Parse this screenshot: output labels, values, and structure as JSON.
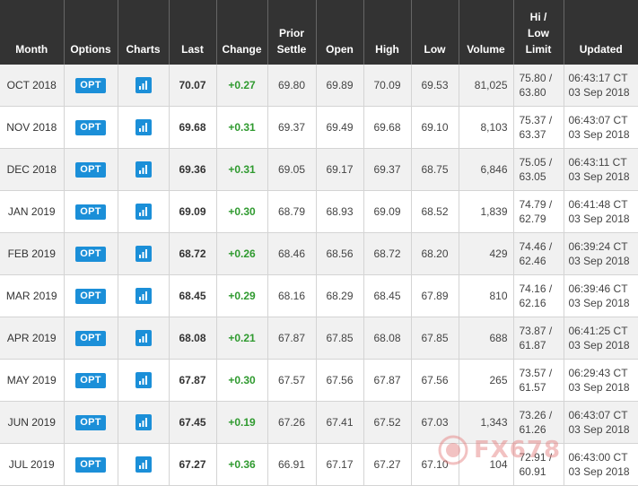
{
  "headers": {
    "month": "Month",
    "options": "Options",
    "charts": "Charts",
    "last": "Last",
    "change": "Change",
    "prior_settle_1": "Prior",
    "prior_settle_2": "Settle",
    "open": "Open",
    "high": "High",
    "low": "Low",
    "volume": "Volume",
    "limit_1": "Hi /",
    "limit_2": "Low",
    "limit_3": "Limit",
    "updated": "Updated"
  },
  "opt_label": "OPT",
  "chart_icon": "bar-chart-icon",
  "colors": {
    "header_bg": "#333333",
    "opt_blue": "#1b8fd8",
    "positive_green": "#2f9a2f",
    "row_alt": "#f1f1f1"
  },
  "rows": [
    {
      "month": "OCT 2018",
      "last": "70.07",
      "change": "+0.27",
      "prior_settle": "69.80",
      "open": "69.89",
      "high": "70.09",
      "low": "69.53",
      "volume": "81,025",
      "hi_limit": "75.80 /",
      "low_limit": "63.80",
      "time": "06:43:17 CT",
      "date": "03 Sep 2018"
    },
    {
      "month": "NOV 2018",
      "last": "69.68",
      "change": "+0.31",
      "prior_settle": "69.37",
      "open": "69.49",
      "high": "69.68",
      "low": "69.10",
      "volume": "8,103",
      "hi_limit": "75.37 /",
      "low_limit": "63.37",
      "time": "06:43:07 CT",
      "date": "03 Sep 2018"
    },
    {
      "month": "DEC 2018",
      "last": "69.36",
      "change": "+0.31",
      "prior_settle": "69.05",
      "open": "69.17",
      "high": "69.37",
      "low": "68.75",
      "volume": "6,846",
      "hi_limit": "75.05 /",
      "low_limit": "63.05",
      "time": "06:43:11 CT",
      "date": "03 Sep 2018"
    },
    {
      "month": "JAN 2019",
      "last": "69.09",
      "change": "+0.30",
      "prior_settle": "68.79",
      "open": "68.93",
      "high": "69.09",
      "low": "68.52",
      "volume": "1,839",
      "hi_limit": "74.79 /",
      "low_limit": "62.79",
      "time": "06:41:48 CT",
      "date": "03 Sep 2018"
    },
    {
      "month": "FEB 2019",
      "last": "68.72",
      "change": "+0.26",
      "prior_settle": "68.46",
      "open": "68.56",
      "high": "68.72",
      "low": "68.20",
      "volume": "429",
      "hi_limit": "74.46 /",
      "low_limit": "62.46",
      "time": "06:39:24 CT",
      "date": "03 Sep 2018"
    },
    {
      "month": "MAR 2019",
      "last": "68.45",
      "change": "+0.29",
      "prior_settle": "68.16",
      "open": "68.29",
      "high": "68.45",
      "low": "67.89",
      "volume": "810",
      "hi_limit": "74.16 /",
      "low_limit": "62.16",
      "time": "06:39:46 CT",
      "date": "03 Sep 2018"
    },
    {
      "month": "APR 2019",
      "last": "68.08",
      "change": "+0.21",
      "prior_settle": "67.87",
      "open": "67.85",
      "high": "68.08",
      "low": "67.85",
      "volume": "688",
      "hi_limit": "73.87 /",
      "low_limit": "61.87",
      "time": "06:41:25 CT",
      "date": "03 Sep 2018"
    },
    {
      "month": "MAY 2019",
      "last": "67.87",
      "change": "+0.30",
      "prior_settle": "67.57",
      "open": "67.56",
      "high": "67.87",
      "low": "67.56",
      "volume": "265",
      "hi_limit": "73.57 /",
      "low_limit": "61.57",
      "time": "06:29:43 CT",
      "date": "03 Sep 2018"
    },
    {
      "month": "JUN 2019",
      "last": "67.45",
      "change": "+0.19",
      "prior_settle": "67.26",
      "open": "67.41",
      "high": "67.52",
      "low": "67.03",
      "volume": "1,343",
      "hi_limit": "73.26 /",
      "low_limit": "61.26",
      "time": "06:43:07 CT",
      "date": "03 Sep 2018"
    },
    {
      "month": "JUL 2019",
      "last": "67.27",
      "change": "+0.36",
      "prior_settle": "66.91",
      "open": "67.17",
      "high": "67.27",
      "low": "67.10",
      "volume": "104",
      "hi_limit": "72.91 /",
      "low_limit": "60.91",
      "time": "06:43:00 CT",
      "date": "03 Sep 2018"
    }
  ],
  "watermark": {
    "text": "FX678",
    "logo": "fx678-logo-icon"
  }
}
